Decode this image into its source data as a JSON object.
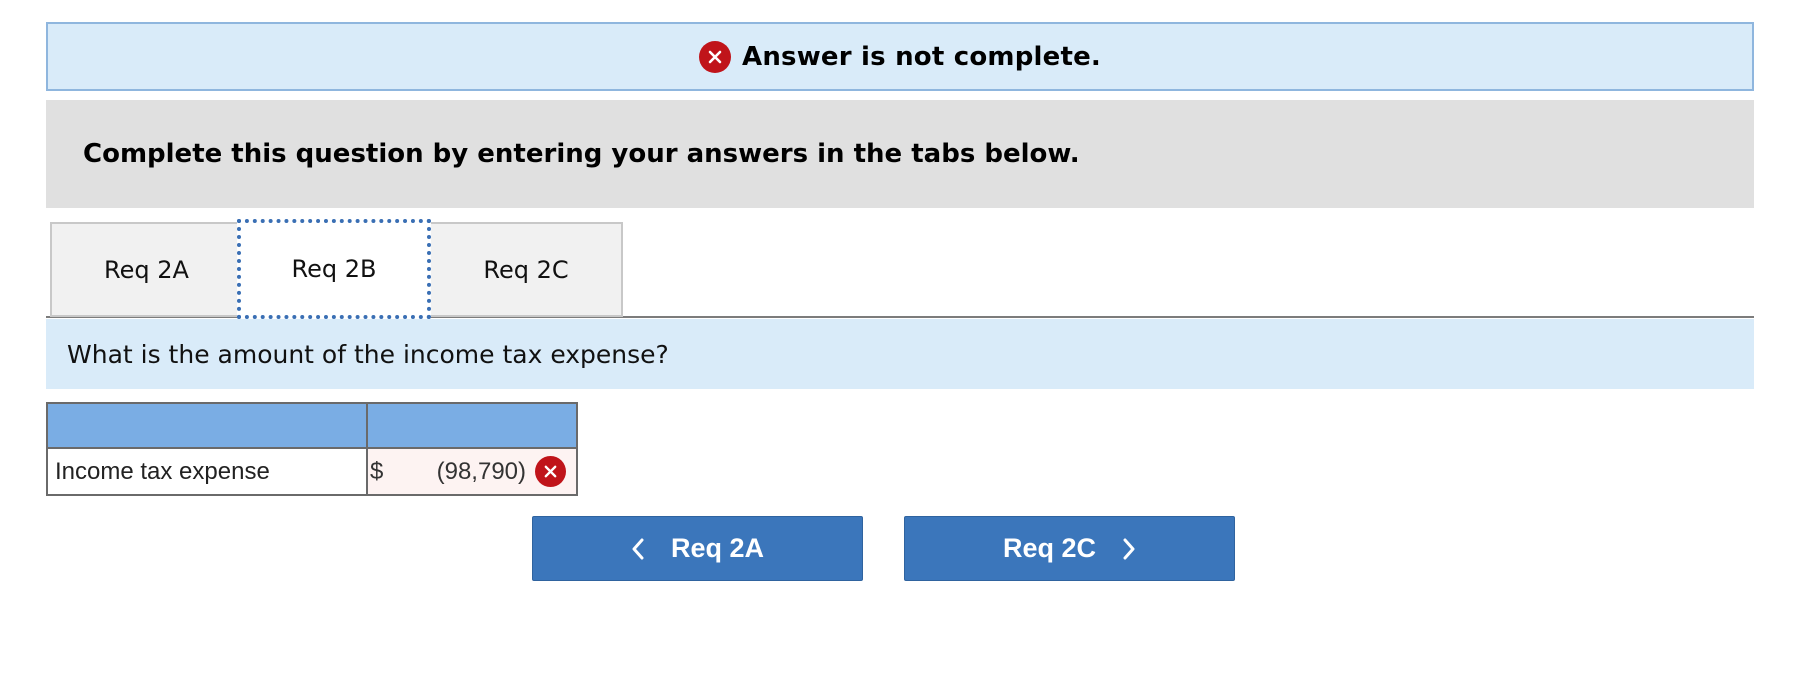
{
  "alert": {
    "text": "Answer is not complete.",
    "icon": "error-x-icon",
    "color": "#c0141a"
  },
  "instruction": {
    "text": "Complete this question by entering your answers in the tabs below."
  },
  "tabs": [
    {
      "label": "Req 2A",
      "active": false
    },
    {
      "label": "Req 2B",
      "active": true
    },
    {
      "label": "Req 2C",
      "active": false
    }
  ],
  "question": {
    "text": "What is the amount of the income tax expense?"
  },
  "table": {
    "header": [
      "",
      ""
    ],
    "rows": [
      {
        "label": "Income tax expense",
        "currency": "$",
        "value": "(98,790)",
        "status": "incorrect"
      }
    ]
  },
  "nav": {
    "prev_label": "Req 2A",
    "next_label": "Req 2C"
  },
  "colors": {
    "accent": "#3b76bb",
    "header_blue": "#7aade4",
    "banner_blue": "#d9ebf9",
    "error_red": "#c0141a"
  }
}
